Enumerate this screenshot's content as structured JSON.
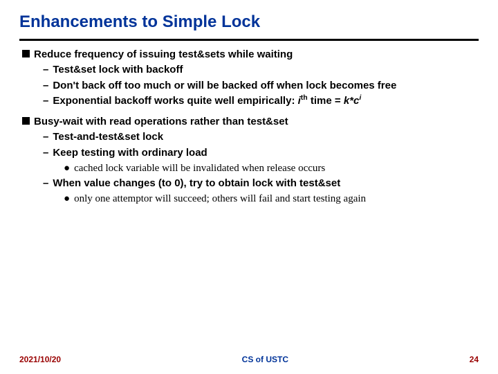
{
  "title": "Enhancements to Simple Lock",
  "bullets": {
    "b1": "Reduce frequency of issuing test&sets while waiting",
    "b1_1": "Test&set lock with backoff",
    "b1_2": "Don't back off too much or will be backed off when lock becomes free",
    "b1_3a": "Exponential backoff works quite well empirically: ",
    "b1_3_i": "i",
    "b1_3_th": "th",
    "b1_3b": " time =  ",
    "b1_3_k": "k*c",
    "b1_3_iexp": "i",
    "b2": "Busy-wait with read operations rather than test&set",
    "b2_1": "Test-and-test&set lock",
    "b2_2": "Keep testing with ordinary load",
    "b2_2_1": "cached lock variable will be invalidated when release occurs",
    "b2_3": "When value changes (to 0), try to obtain lock with test&set",
    "b2_3_1": "only one attemptor will succeed; others will fail and start testing again"
  },
  "footer": {
    "date": "2021/10/20",
    "center": "CS of USTC",
    "page": "24"
  }
}
